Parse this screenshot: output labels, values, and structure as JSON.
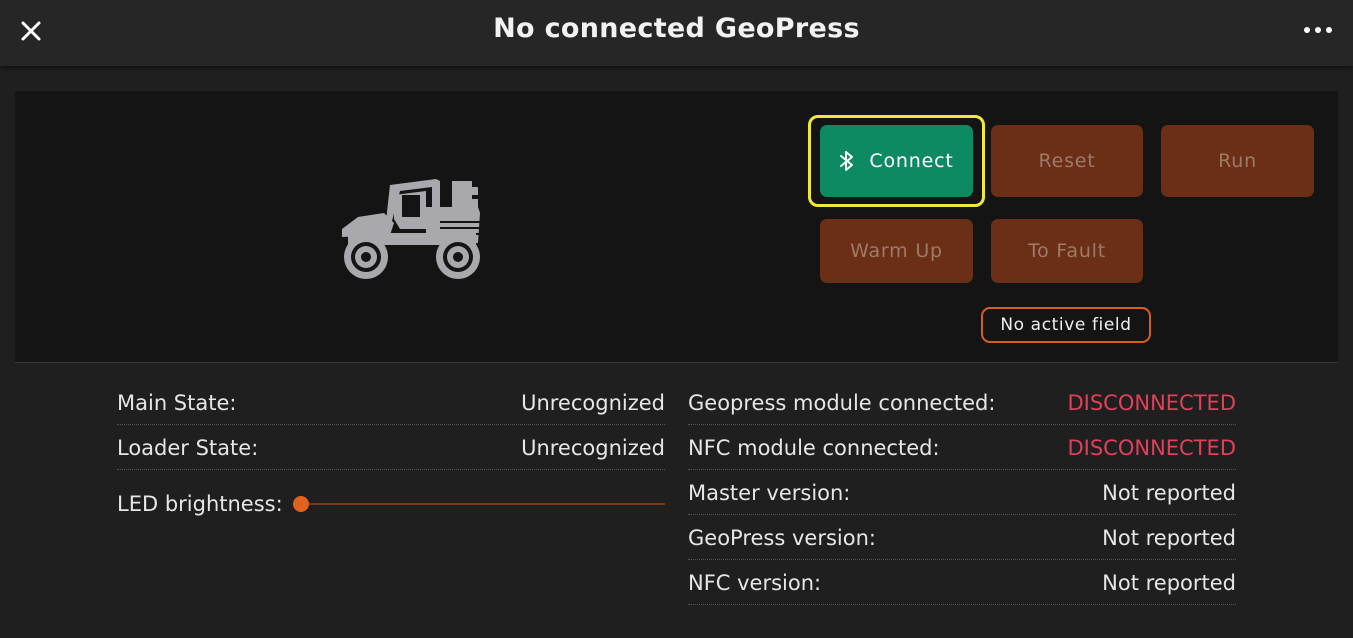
{
  "header": {
    "title": "No connected GeoPress"
  },
  "controls": {
    "connect_label": "Connect",
    "reset_label": "Reset",
    "run_label": "Run",
    "warmup_label": "Warm Up",
    "tofault_label": "To Fault",
    "field_status": "No active field"
  },
  "left_status": [
    {
      "label": "Main State:",
      "value": "Unrecognized"
    },
    {
      "label": "Loader State:",
      "value": "Unrecognized"
    }
  ],
  "led": {
    "label": "LED brightness:",
    "level": 0
  },
  "right_status": [
    {
      "label": "Geopress module connected:",
      "value": "DISCONNECTED"
    },
    {
      "label": "NFC module connected:",
      "value": "DISCONNECTED"
    },
    {
      "label": "Master version:",
      "value": "Not reported"
    },
    {
      "label": "GeoPress version:",
      "value": "Not reported"
    },
    {
      "label": "NFC version:",
      "value": "Not reported"
    }
  ],
  "colors": {
    "accent": "#0e8a62",
    "fault_button": "#6b2e16",
    "disconnected": "#e0405a",
    "highlight": "#f3e83a"
  },
  "icons": [
    "close-icon",
    "more-icon",
    "bluetooth-icon",
    "utv-vehicle-icon"
  ]
}
